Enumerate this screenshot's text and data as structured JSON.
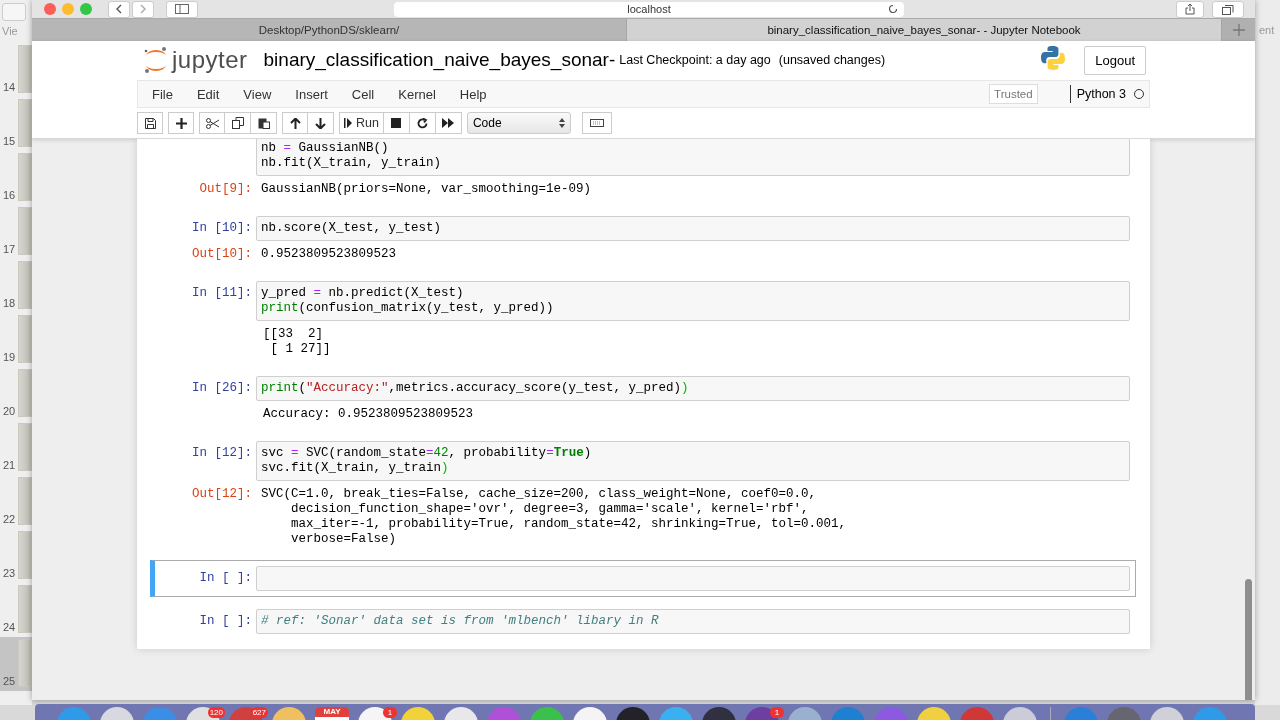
{
  "desktop": {
    "left_label": "Vie",
    "right_label": "ent"
  },
  "page_strip": [
    {
      "number": "14",
      "selected": false
    },
    {
      "number": "15",
      "selected": false
    },
    {
      "number": "16",
      "selected": false
    },
    {
      "number": "17",
      "selected": false
    },
    {
      "number": "18",
      "selected": false
    },
    {
      "number": "19",
      "selected": false
    },
    {
      "number": "20",
      "selected": false
    },
    {
      "number": "21",
      "selected": false
    },
    {
      "number": "22",
      "selected": false
    },
    {
      "number": "23",
      "selected": false
    },
    {
      "number": "24",
      "selected": false
    },
    {
      "number": "25",
      "selected": true
    }
  ],
  "browser": {
    "address": "localhost",
    "tabs": [
      {
        "title": "Desktop/PythonDS/sklearn/",
        "selected": false
      },
      {
        "title": "binary_classification_naive_bayes_sonar- - Jupyter Notebook",
        "selected": true
      }
    ]
  },
  "notebook": {
    "logo_text": "jupyter",
    "name": "binary_classification_naive_bayes_sonar-",
    "checkpoint": "Last Checkpoint: a day ago",
    "unsaved": "(unsaved changes)",
    "logout": "Logout",
    "menus": [
      "File",
      "Edit",
      "View",
      "Insert",
      "Cell",
      "Kernel",
      "Help"
    ],
    "trusted": "Trusted",
    "kernel": "Python 3",
    "kernel_busy": false,
    "toolbar": {
      "run": "Run",
      "cell_type": "Code"
    }
  },
  "cells": [
    {
      "selected": false,
      "lines": [
        [
          {
            "kind": "plain",
            "text": "nb "
          },
          {
            "kind": "op",
            "text": "="
          },
          {
            "kind": "plain",
            "text": " GaussianNB()"
          }
        ],
        [
          {
            "kind": "plain",
            "text": "nb.fit(X_train, y_train)"
          }
        ]
      ],
      "output": {
        "kind": "result",
        "prompt": "Out[9]:",
        "lines": [
          "GaussianNB(priors=None, var_smoothing=1e-09)"
        ]
      }
    },
    {
      "selected": false,
      "prompt": "In [10]:",
      "lines": [
        [
          {
            "kind": "plain",
            "text": "nb.score(X_test, y_test)"
          }
        ]
      ],
      "output": {
        "kind": "result",
        "prompt": "Out[10]:",
        "lines": [
          "0.9523809523809523"
        ]
      }
    },
    {
      "selected": false,
      "prompt": "In [11]:",
      "lines": [
        [
          {
            "kind": "plain",
            "text": "y_pred "
          },
          {
            "kind": "op",
            "text": "="
          },
          {
            "kind": "plain",
            "text": " nb.predict(X_test)"
          }
        ],
        [
          {
            "kind": "builtin",
            "text": "print"
          },
          {
            "kind": "plain",
            "text": "(confusion_matrix(y_test, y_pred))"
          }
        ]
      ],
      "output": {
        "kind": "stream",
        "lines": [
          "[[33  2]",
          " [ 1 27]]"
        ]
      }
    },
    {
      "selected": false,
      "prompt": "In [26]:",
      "lines": [
        [
          {
            "kind": "builtin",
            "text": "print"
          },
          {
            "kind": "plain",
            "text": "("
          },
          {
            "kind": "string",
            "text": "\"Accuracy:\""
          },
          {
            "kind": "plain",
            "text": ",metrics.accuracy_score(y_test, y_pred)"
          },
          {
            "kind": "match",
            "text": ")"
          }
        ]
      ],
      "output": {
        "kind": "stream",
        "lines": [
          "Accuracy: 0.9523809523809523"
        ]
      }
    },
    {
      "selected": false,
      "prompt": "In [12]:",
      "lines": [
        [
          {
            "kind": "plain",
            "text": "svc "
          },
          {
            "kind": "op",
            "text": "="
          },
          {
            "kind": "plain",
            "text": " SVC(random_state"
          },
          {
            "kind": "op",
            "text": "="
          },
          {
            "kind": "number",
            "text": "42"
          },
          {
            "kind": "plain",
            "text": ", probability"
          },
          {
            "kind": "op",
            "text": "="
          },
          {
            "kind": "keyword",
            "text": "True"
          },
          {
            "kind": "plain",
            "text": ")"
          }
        ],
        [
          {
            "kind": "plain",
            "text": "svc.fit(X_train, y_train"
          },
          {
            "kind": "match",
            "text": ")"
          }
        ]
      ],
      "output": {
        "kind": "result",
        "prompt": "Out[12]:",
        "lines": [
          "SVC(C=1.0, break_ties=False, cache_size=200, class_weight=None, coef0=0.0,",
          "    decision_function_shape='ovr', degree=3, gamma='scale', kernel='rbf',",
          "    max_iter=-1, probability=True, random_state=42, shrinking=True, tol=0.001,",
          "    verbose=False)"
        ]
      }
    },
    {
      "selected": true,
      "prompt": "In [ ]:"
    },
    {
      "selected": false,
      "prompt": "In [ ]:",
      "lines": [
        [
          {
            "kind": "comment",
            "text": "# ref: 'Sonar' data set is from 'mlbench' libary in R"
          }
        ]
      ]
    }
  ],
  "dock": [
    {
      "kind": "app"
    },
    {
      "kind": "app"
    },
    {
      "kind": "app"
    },
    {
      "kind": "app",
      "badge": "120"
    },
    {
      "kind": "app",
      "badge": "627"
    },
    {
      "kind": "app"
    },
    {
      "kind": "calendar",
      "month": "MAY"
    },
    {
      "kind": "app",
      "badge": "1"
    },
    {
      "kind": "app"
    },
    {
      "kind": "app"
    },
    {
      "kind": "app"
    },
    {
      "kind": "app"
    },
    {
      "kind": "app"
    },
    {
      "kind": "app"
    },
    {
      "kind": "app"
    },
    {
      "kind": "app"
    },
    {
      "kind": "app",
      "badge": "1"
    },
    {
      "kind": "app"
    },
    {
      "kind": "app"
    },
    {
      "kind": "app"
    },
    {
      "kind": "app"
    },
    {
      "kind": "app"
    },
    {
      "kind": "app"
    },
    {
      "kind": "separator"
    },
    {
      "kind": "app"
    },
    {
      "kind": "app"
    },
    {
      "kind": "app"
    },
    {
      "kind": "app"
    }
  ]
}
